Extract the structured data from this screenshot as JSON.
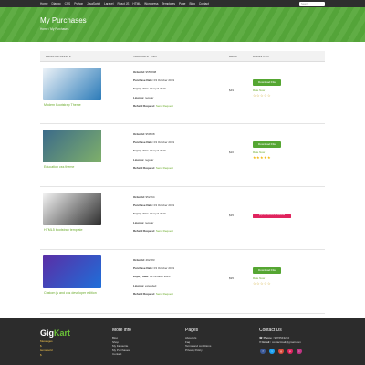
{
  "nav": {
    "links": [
      "Home",
      "Django",
      "CSS",
      "Python",
      "JavaScript",
      "Laravel",
      "React JS",
      "HTML",
      "Wordpress",
      "Templates",
      "Page",
      "Blog",
      "Contact"
    ],
    "search_placeholder": "Search"
  },
  "banner": {
    "title": "My Purchases",
    "breadcrumb": "Home / My Purchases"
  },
  "table": {
    "headers": {
      "product": "PRODUCT DETAILS",
      "info": "ADDITIONAL INFO",
      "price": "PRICE",
      "download": "DOWNLOAD"
    },
    "labels": {
      "order": "Order Id:",
      "purchase_date": "Purchase Date:",
      "expiry": "Expiry date:",
      "licence": "Licence:",
      "refund": "Refund Request:",
      "send_request": "Send Request",
      "download_file": "Download File",
      "rate_now": "Rate Now"
    },
    "rows": [
      {
        "product": "Modern Bootstrap Theme",
        "order": "9559808",
        "purchase_date": "03 October 2019",
        "expiry": "03 April 2020",
        "licence": "regular",
        "price": "$49",
        "download": true,
        "stars": "☆☆☆☆☆",
        "stars_color": "#c9a21d",
        "colors": [
          "#eef3f8",
          "#2a7ab8"
        ]
      },
      {
        "product": "Education css theme",
        "order": "959508",
        "purchase_date": "03 October 2019",
        "expiry": "03 April 2020",
        "licence": "regular",
        "price": "$20",
        "download": true,
        "stars": "★★★★★",
        "stars_color": "#f0b400",
        "colors": [
          "#3b6a8a",
          "#7fb06a"
        ]
      },
      {
        "product": "HTML5 bootstrap template",
        "order": "952164",
        "purchase_date": "03 October 2019",
        "expiry": "03 April 2020",
        "licence": "regular",
        "price": "$35",
        "download": false,
        "badge": "payment released for undefined",
        "colors": [
          "#f4f4f4",
          "#2d2d2d"
        ]
      },
      {
        "product": "Custom js and css developer edition",
        "order": "492183",
        "purchase_date": "03 October 2019",
        "expiry": "03 October 2020",
        "licence": "extended",
        "price": "$95",
        "download": true,
        "stars": "☆☆☆☆☆",
        "stars_color": "#c9a21d",
        "colors": [
          "#5a2ea6",
          "#1e6fd9"
        ]
      }
    ]
  },
  "footer": {
    "brand_a": "Gig",
    "brand_b": "Kart",
    "side_links": [
      "Messages",
      "$",
      "items sold",
      "$"
    ],
    "more_info": {
      "heading": "More info",
      "links": [
        "Blog",
        "Shop",
        "My Favourite",
        "My Purchases",
        "Contact"
      ]
    },
    "pages": {
      "heading": "Pages",
      "links": [
        "About Us",
        "Faq",
        "Terms and conditions",
        "Privacy Policy"
      ]
    },
    "contact": {
      "heading": "Contact Us",
      "phone_label": "Phone :",
      "phone": "9876543210",
      "email_label": "Email :",
      "email": "contactmail@gmail.com"
    },
    "socials": [
      {
        "name": "facebook",
        "glyph": "f",
        "color": "#3b5998"
      },
      {
        "name": "twitter",
        "glyph": "t",
        "color": "#1da1f2"
      },
      {
        "name": "google-plus",
        "glyph": "g",
        "color": "#dd4b39"
      },
      {
        "name": "pinterest",
        "glyph": "p",
        "color": "#e0245e"
      },
      {
        "name": "instagram",
        "glyph": "i",
        "color": "#c13584"
      }
    ]
  }
}
